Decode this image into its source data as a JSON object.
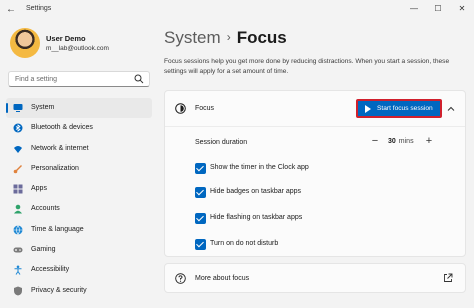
{
  "window": {
    "title": "Settings",
    "back_glyph": "←",
    "minimize_glyph": "—",
    "maximize_glyph": "☐",
    "close_glyph": "✕"
  },
  "user": {
    "name": "User Demo",
    "email": "m__lab@outlook.com"
  },
  "search": {
    "placeholder": "Find a setting",
    "icon": "search-icon"
  },
  "nav": {
    "items": [
      {
        "label": "System",
        "icon": "monitor-icon",
        "color": "#0067c0",
        "active": true
      },
      {
        "label": "Bluetooth & devices",
        "icon": "bluetooth-icon",
        "color": "#0067c0"
      },
      {
        "label": "Network & internet",
        "icon": "wifi-icon",
        "color": "#0067c0"
      },
      {
        "label": "Personalization",
        "icon": "brush-icon",
        "color": "#e0823d"
      },
      {
        "label": "Apps",
        "icon": "apps-icon",
        "color": "#6b6b9b"
      },
      {
        "label": "Accounts",
        "icon": "person-icon",
        "color": "#2fa36b"
      },
      {
        "label": "Time & language",
        "icon": "globe-icon",
        "color": "#1e88d4"
      },
      {
        "label": "Gaming",
        "icon": "gamepad-icon",
        "color": "#7a7a7a"
      },
      {
        "label": "Accessibility",
        "icon": "accessibility-icon",
        "color": "#1e88d4"
      },
      {
        "label": "Privacy & security",
        "icon": "shield-icon",
        "color": "#7a7a7a"
      }
    ]
  },
  "breadcrumb": {
    "parent": "System",
    "separator": "›",
    "current": "Focus"
  },
  "description": "Focus sessions help you get more done by reducing distractions. When you start a session, these settings will apply for a set amount of time.",
  "focus_card": {
    "label": "Focus",
    "start_button": "Start focus session",
    "duration_label": "Session duration",
    "duration_value": "30",
    "duration_unit": "mins",
    "minus_glyph": "−",
    "plus_glyph": "+",
    "options": [
      {
        "label": "Show the timer in the Clock app",
        "checked": true
      },
      {
        "label": "Hide badges on taskbar apps",
        "checked": true
      },
      {
        "label": "Hide flashing on taskbar apps",
        "checked": true
      },
      {
        "label": "Turn on do not disturb",
        "checked": true
      }
    ]
  },
  "more_card": {
    "label": "More about focus"
  },
  "colors": {
    "accent": "#0067c0",
    "highlight_border": "#d0202d",
    "background": "#f3f3f3"
  }
}
